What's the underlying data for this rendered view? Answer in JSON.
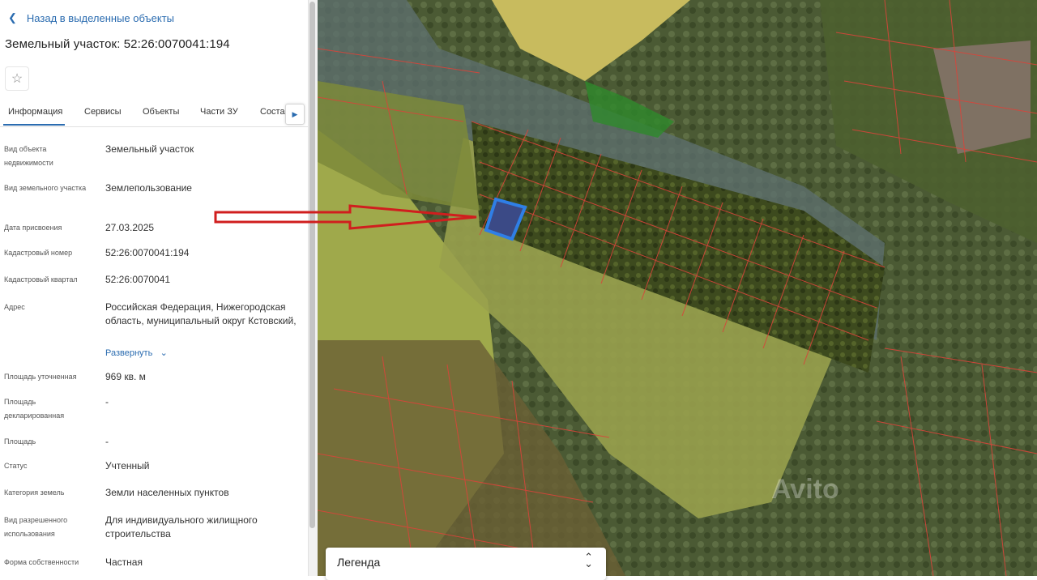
{
  "panel": {
    "back_label": "Назад в выделенные объекты",
    "title": "Земельный участок: 52:26:0070041:194",
    "favorite_icon": "star-icon",
    "tabs": [
      "Информация",
      "Сервисы",
      "Объекты",
      "Части ЗУ",
      "Соста"
    ],
    "active_tab": "Информация",
    "fields": [
      {
        "label": "Вид объекта недвижимости",
        "value": "Земельный участок"
      },
      {
        "label": "Вид земельного участка",
        "value": "Землепользование"
      },
      {
        "label": "Дата присвоения",
        "value": "27.03.2025"
      },
      {
        "label": "Кадастровый номер",
        "value": "52:26:0070041:194"
      },
      {
        "label": "Кадастровый квартал",
        "value": "52:26:0070041"
      },
      {
        "label": "Адрес",
        "value": "Российская Федерация, Нижегородская область, муниципальный округ Кстовский,"
      },
      {
        "label": "Площадь уточненная",
        "value": "969 кв. м"
      },
      {
        "label": "Площадь декларированная",
        "value": "-"
      },
      {
        "label": "Площадь",
        "value": "-"
      },
      {
        "label": "Статус",
        "value": "Учтенный"
      },
      {
        "label": "Категория земель",
        "value": "Земли населенных пунктов"
      },
      {
        "label": "Вид разрешенного использования",
        "value": "Для индивидуального жилищного строительства"
      },
      {
        "label": "Форма собственности",
        "value": "Частная"
      }
    ],
    "expand_label": "Развернуть"
  },
  "map": {
    "legend_label": "Легенда",
    "watermark": "Avito",
    "highlight_color": "#2f7fe6",
    "parcel_border_color": "#d9443a",
    "arrow_color": "#d01e1e"
  }
}
